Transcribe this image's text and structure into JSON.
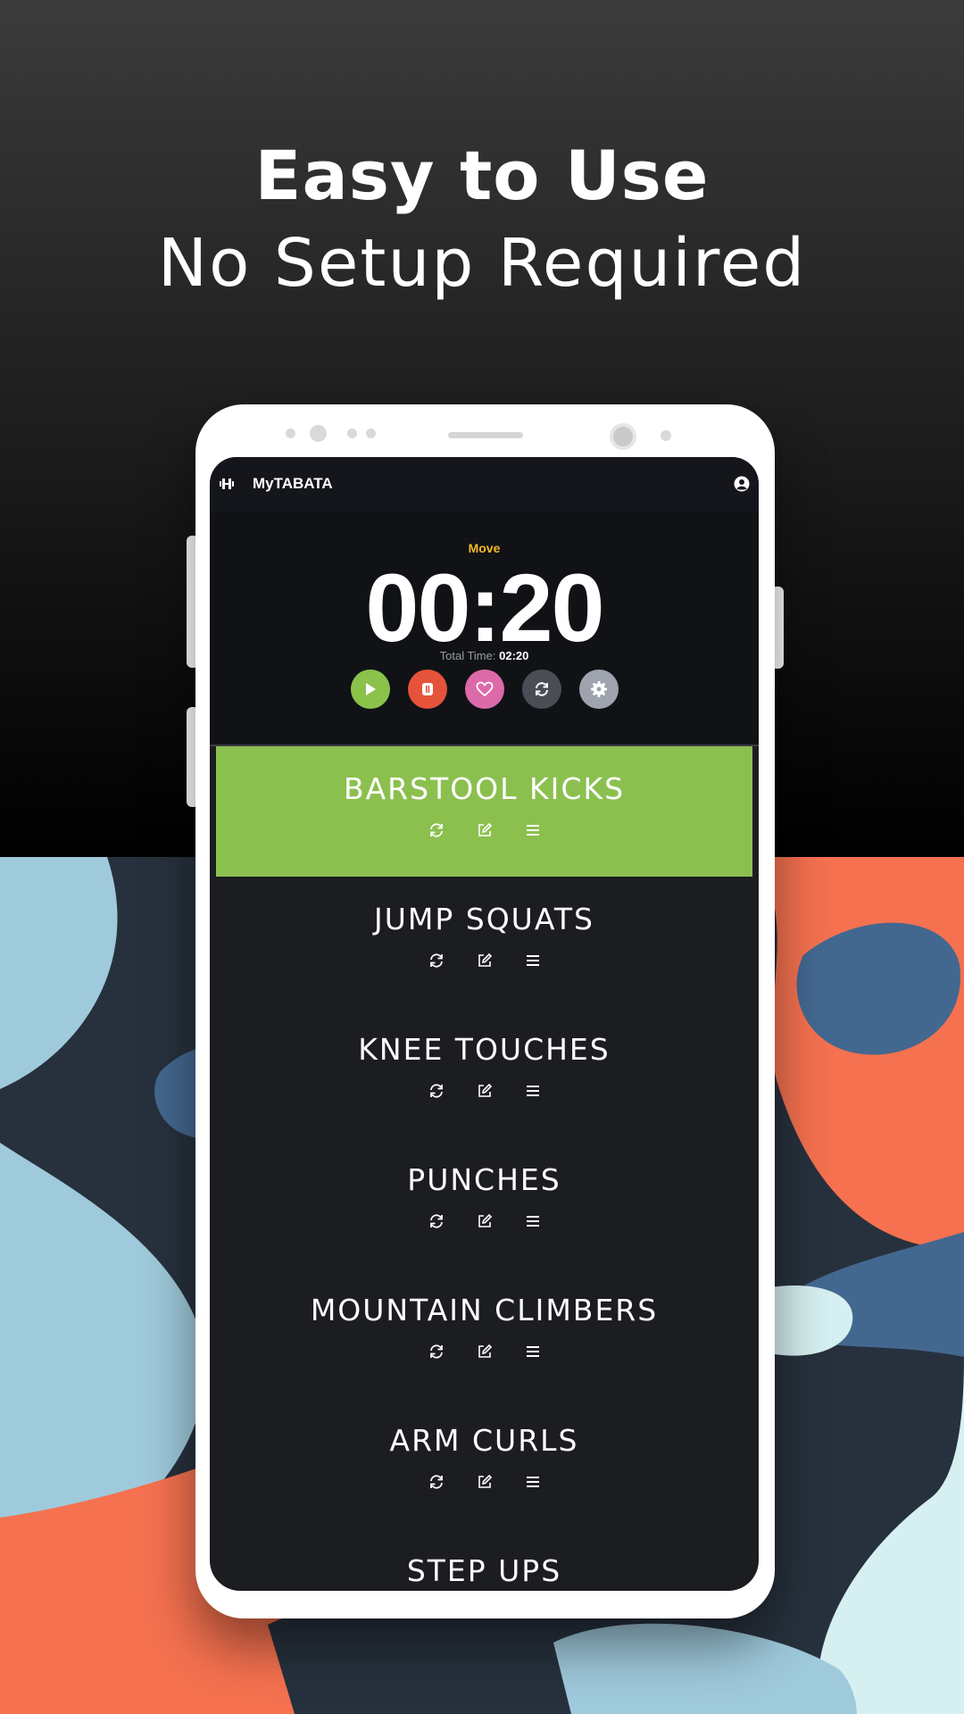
{
  "headline": {
    "bold": "Easy to Use",
    "light": "No Setup Required"
  },
  "app": {
    "logo_icon": "barbell-icon",
    "title": "MyTABATA",
    "account_icon": "account-circle-icon"
  },
  "timer": {
    "phase": "Move",
    "clock": "00:20",
    "total_label": "Total Time:",
    "total_value": "02:20"
  },
  "controls": [
    {
      "name": "play-button",
      "icon": "play-icon",
      "color": "#8bc24a"
    },
    {
      "name": "pause-button",
      "icon": "pause-icon",
      "color": "#e5533a"
    },
    {
      "name": "favorite-button",
      "icon": "heart-icon",
      "color": "#dc6aa9"
    },
    {
      "name": "repeat-button",
      "icon": "repeat-icon",
      "color": "#4a4d55"
    },
    {
      "name": "settings-button",
      "icon": "gear-icon",
      "color": "#9ea3ad"
    }
  ],
  "exercises": [
    {
      "name": "BARSTOOL KICKS",
      "active": true
    },
    {
      "name": "JUMP SQUATS",
      "active": false
    },
    {
      "name": "KNEE TOUCHES",
      "active": false
    },
    {
      "name": "PUNCHES",
      "active": false
    },
    {
      "name": "MOUNTAIN CLIMBERS",
      "active": false
    },
    {
      "name": "ARM CURLS",
      "active": false
    },
    {
      "name": "STEP UPS",
      "active": false
    }
  ],
  "exercise_actions": [
    "repeat-icon",
    "edit-icon",
    "reorder-icon"
  ],
  "colors": {
    "active_exercise": "#8bc04f",
    "phase": "#f6b926",
    "screen_bg": "#1c1d21"
  }
}
